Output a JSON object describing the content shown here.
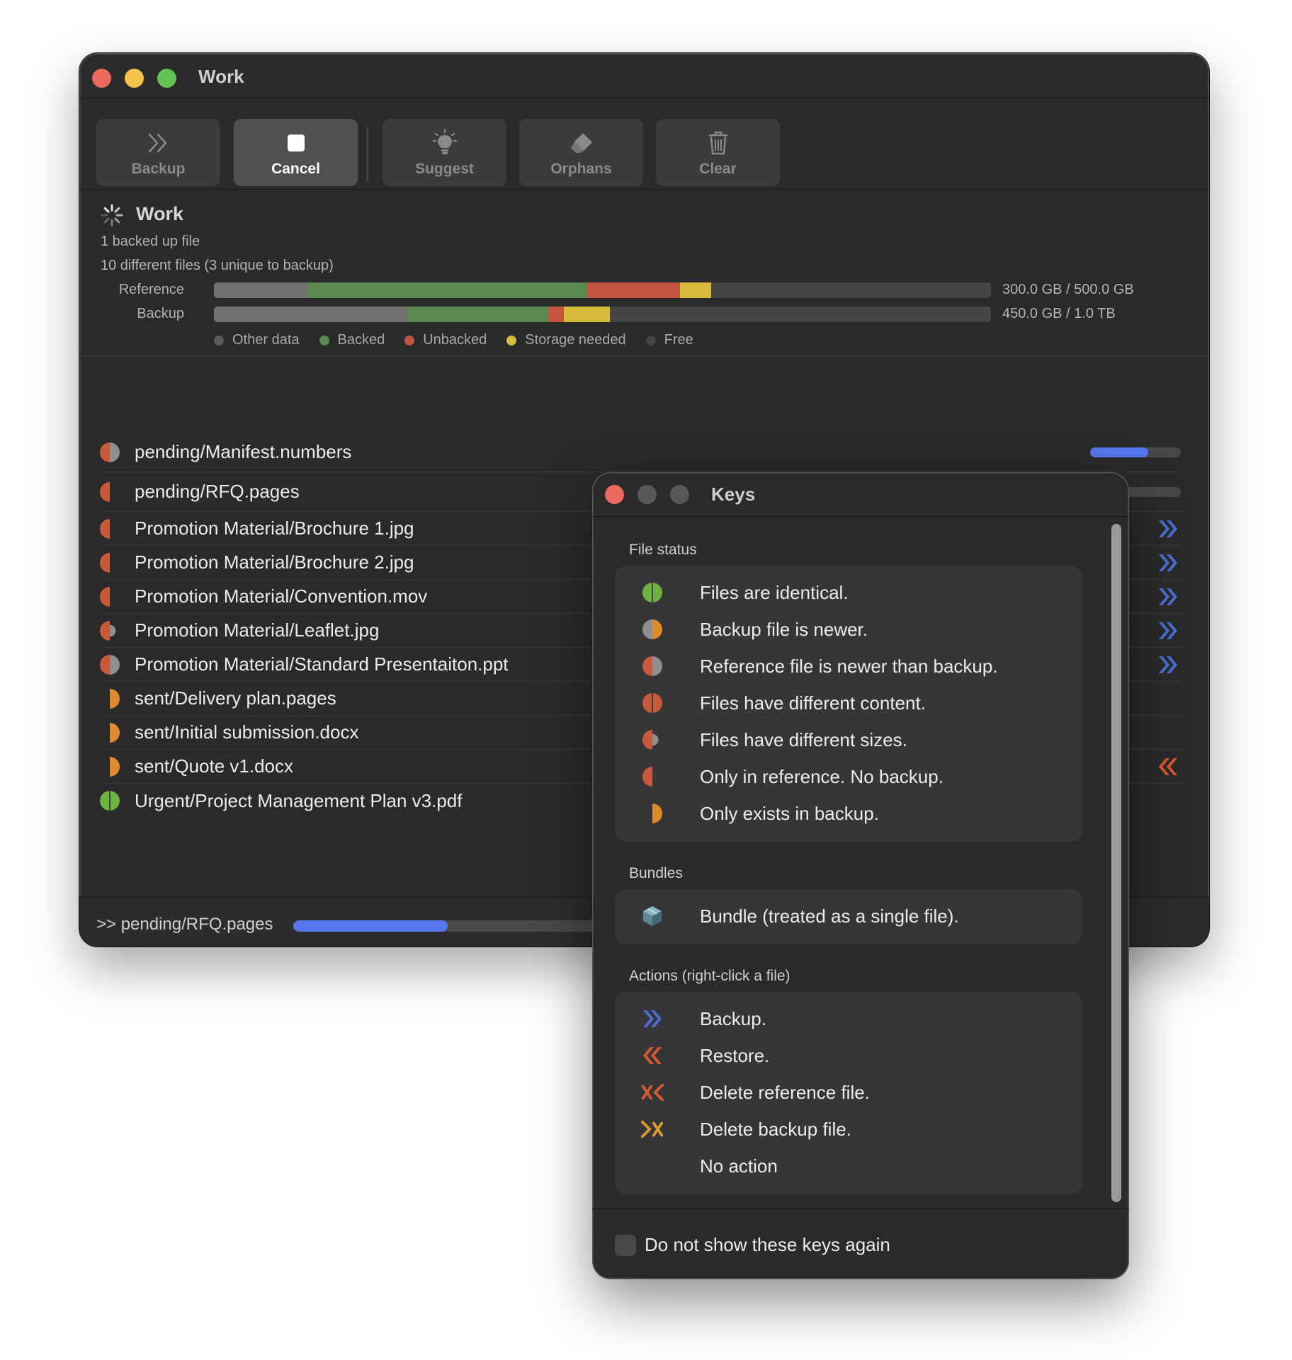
{
  "window": {
    "title": "Work",
    "toolbar": {
      "backup": "Backup",
      "cancel": "Cancel",
      "suggest": "Suggest",
      "orphans": "Orphans",
      "clear": "Clear"
    },
    "summary": {
      "title": "Work",
      "line1": "1 backed up file",
      "line2": "10 different files (3 unique to backup)",
      "reference_label": "Reference",
      "reference_value": "300.0 GB / 500.0 GB",
      "backup_label": "Backup",
      "backup_value": "450.0 GB / 1.0 TB"
    },
    "legend": {
      "other": "Other data",
      "backed": "Backed",
      "unbacked": "Unbacked",
      "storage": "Storage needed",
      "free": "Free"
    },
    "files": [
      {
        "name": "pending/Manifest.numbers",
        "status": "ref-newer",
        "progress": 0.64
      },
      {
        "name": "pending/RFQ.pages",
        "status": "only-ref",
        "progress": 0.29
      },
      {
        "name": "Promotion Material/Brochure 1.jpg",
        "status": "only-ref",
        "action": "backup"
      },
      {
        "name": "Promotion Material/Brochure 2.jpg",
        "status": "only-ref",
        "action": "backup"
      },
      {
        "name": "Promotion Material/Convention.mov",
        "status": "only-ref",
        "action": "backup"
      },
      {
        "name": "Promotion Material/Leaflet.jpg",
        "status": "different-sizes",
        "action": "backup"
      },
      {
        "name": "Promotion Material/Standard Presentaiton.ppt",
        "status": "ref-newer",
        "action": "backup"
      },
      {
        "name": "sent/Delivery plan.pages",
        "status": "only-backup"
      },
      {
        "name": "sent/Initial submission.docx",
        "status": "only-backup"
      },
      {
        "name": "sent/Quote v1.docx",
        "status": "only-backup",
        "action": "restore"
      },
      {
        "name": "Urgent/Project Management Plan v3.pdf",
        "status": "identical"
      }
    ],
    "status_bar": {
      "text": ">> pending/RFQ.pages",
      "progress": 0.39
    }
  },
  "keys_panel": {
    "title": "Keys",
    "file_status_header": "File status",
    "file_status": [
      {
        "icon": "identical-icon",
        "text": "Files are identical."
      },
      {
        "icon": "backup-newer-icon",
        "text": "Backup file is newer."
      },
      {
        "icon": "reference-newer-icon",
        "text": "Reference file is newer than backup."
      },
      {
        "icon": "different-content-icon",
        "text": "Files have different content."
      },
      {
        "icon": "different-sizes-icon",
        "text": "Files have different sizes."
      },
      {
        "icon": "only-reference-icon",
        "text": "Only in reference. No backup."
      },
      {
        "icon": "only-backup-icon",
        "text": "Only exists in backup."
      }
    ],
    "bundles_header": "Bundles",
    "bundles": [
      {
        "icon": "bundle-icon",
        "text": "Bundle (treated as a single file)."
      }
    ],
    "actions_header": "Actions (right-click a file)",
    "actions": [
      {
        "icon": "backup-action-icon",
        "text": "Backup."
      },
      {
        "icon": "restore-action-icon",
        "text": "Restore."
      },
      {
        "icon": "delete-reference-icon",
        "text": "Delete reference file."
      },
      {
        "icon": "delete-backup-icon",
        "text": "Delete backup file."
      },
      {
        "icon": "",
        "text": "No action"
      }
    ],
    "checkbox_label": "Do not show these keys again",
    "checkbox_checked": false
  },
  "colors": {
    "other": "#707072",
    "backed": "#5b8a4e",
    "unbacked": "#c4533f",
    "storage": "#d8bb3c",
    "free": "#454547",
    "accent": "#5577ee",
    "ref_half": "#c85a3a",
    "backup_half": "#e08a2c",
    "green_half": "#6db33f"
  }
}
